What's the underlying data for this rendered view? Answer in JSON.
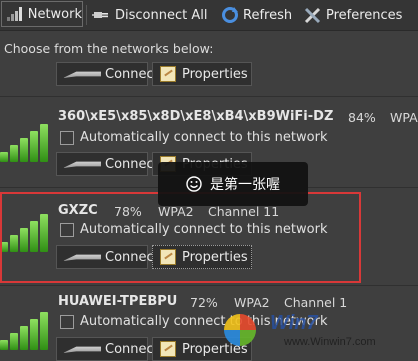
{
  "toolbar": {
    "network_label": "Network",
    "disconnect_all_label": "Disconnect All",
    "refresh_label": "Refresh",
    "preferences_label": "Preferences"
  },
  "prompt": "Choose from the networks below:",
  "buttons": {
    "connect": "Connect",
    "properties": "Properties"
  },
  "networks": [
    {
      "name": "360\\xE5\\x85\\x8D\\xE8\\xB4\\xB9WiFi-DZ",
      "signal": "84%",
      "security": "WPA",
      "channel": "",
      "auto_connect_label": "Automatically connect to this network",
      "auto_connect": false
    },
    {
      "name": "GXZC",
      "signal": "78%",
      "security": "WPA2",
      "channel": "Channel 11",
      "auto_connect_label": "Automatically connect to this network",
      "auto_connect": false
    },
    {
      "name": "HUAWEI-TPEBPU",
      "signal": "72%",
      "security": "WPA2",
      "channel": "Channel 1",
      "auto_connect_label": "Automatically connect to this network",
      "auto_connect": false
    }
  ],
  "toast": {
    "text": "是第一张喔"
  },
  "watermark": {
    "brand": "Win7",
    "url": "www.Winwin7.com"
  },
  "colors": {
    "background": "#3f3f3f",
    "highlight_border": "#d83838",
    "signal_green": "#5cc23a"
  }
}
